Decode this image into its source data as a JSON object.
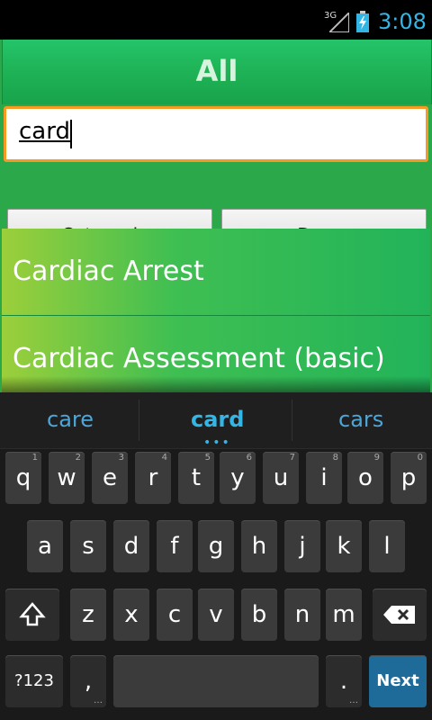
{
  "status": {
    "network": "3G",
    "time": "3:08"
  },
  "app": {
    "title": "All",
    "search": {
      "value": "card",
      "placeholder": ""
    },
    "buttons": {
      "categories": "Categories",
      "drugs": "Drugs"
    },
    "results": [
      "Cardiac Arrest",
      "Cardiac Assessment (basic)"
    ]
  },
  "keyboard": {
    "suggestions": [
      "care",
      "card",
      "cars"
    ],
    "row1": [
      {
        "key": "q",
        "hint": "1"
      },
      {
        "key": "w",
        "hint": "2"
      },
      {
        "key": "e",
        "hint": "3"
      },
      {
        "key": "r",
        "hint": "4"
      },
      {
        "key": "t",
        "hint": "5"
      },
      {
        "key": "y",
        "hint": "6"
      },
      {
        "key": "u",
        "hint": "7"
      },
      {
        "key": "i",
        "hint": "8"
      },
      {
        "key": "o",
        "hint": "9"
      },
      {
        "key": "p",
        "hint": "0"
      }
    ],
    "row2": [
      "a",
      "s",
      "d",
      "f",
      "g",
      "h",
      "j",
      "k",
      "l"
    ],
    "row3": [
      "z",
      "x",
      "c",
      "v",
      "b",
      "n",
      "m"
    ],
    "bottom": {
      "symbols": "?123",
      "comma": ",",
      "period": ".",
      "next": "Next"
    }
  },
  "colors": {
    "accent": "#33b5e5",
    "title_bar": "#1fb256",
    "search_border": "#f59a23"
  }
}
